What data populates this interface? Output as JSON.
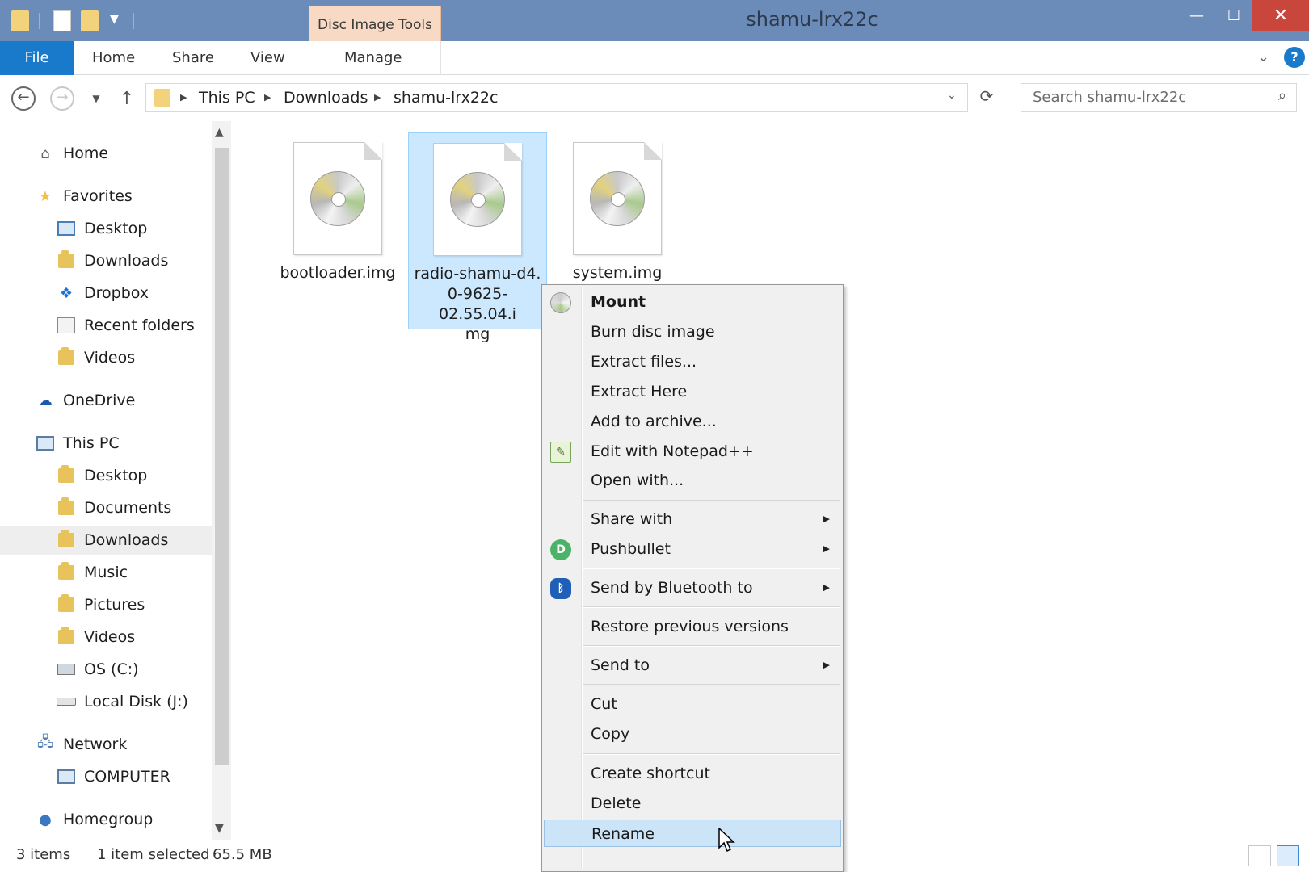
{
  "window": {
    "title": "shamu-lrx22c",
    "contextual_tab_group": "Disc Image Tools",
    "controls": {
      "minimize": "—",
      "maximize": "☐",
      "close": "✕"
    }
  },
  "ribbon": {
    "tabs": [
      "File",
      "Home",
      "Share",
      "View",
      "Manage"
    ],
    "help": "?"
  },
  "address": {
    "breadcrumbs": [
      "This PC",
      "Downloads",
      "shamu-lrx22c"
    ],
    "search_placeholder": "Search shamu-lrx22c"
  },
  "nav": {
    "items": [
      {
        "label": "Home",
        "icon": "home-icon"
      },
      {
        "label": "Favorites",
        "icon": "star-icon"
      },
      {
        "label": "Desktop",
        "icon": "desktop-icon"
      },
      {
        "label": "Downloads",
        "icon": "downloads-folder-icon"
      },
      {
        "label": "Dropbox",
        "icon": "dropbox-icon"
      },
      {
        "label": "Recent folders",
        "icon": "recent-folders-icon"
      },
      {
        "label": "Videos",
        "icon": "videos-folder-icon"
      },
      {
        "label": "OneDrive",
        "icon": "onedrive-icon"
      },
      {
        "label": "This PC",
        "icon": "computer-icon"
      },
      {
        "label": "Desktop",
        "icon": "folder-icon"
      },
      {
        "label": "Documents",
        "icon": "folder-icon"
      },
      {
        "label": "Downloads",
        "icon": "folder-icon"
      },
      {
        "label": "Music",
        "icon": "folder-icon"
      },
      {
        "label": "Pictures",
        "icon": "folder-icon"
      },
      {
        "label": "Videos",
        "icon": "folder-icon"
      },
      {
        "label": "OS (C:)",
        "icon": "drive-icon"
      },
      {
        "label": "Local Disk (J:)",
        "icon": "disk-icon"
      },
      {
        "label": "Network",
        "icon": "network-icon"
      },
      {
        "label": "COMPUTER",
        "icon": "computer-icon"
      },
      {
        "label": "Homegroup",
        "icon": "homegroup-icon"
      }
    ],
    "selected_index": 11
  },
  "files": [
    {
      "name": "bootloader.img",
      "selected": false
    },
    {
      "name_lines": [
        "radio-shamu-d4.",
        "0-9625-02.55.04.i",
        "mg"
      ],
      "selected": true
    },
    {
      "name": "system.img",
      "selected": false
    }
  ],
  "context_menu": {
    "items": [
      {
        "label": "Mount",
        "bold": true,
        "icon": "disc-icon"
      },
      {
        "label": "Burn disc image"
      },
      {
        "label": "Extract files..."
      },
      {
        "label": "Extract Here"
      },
      {
        "label": "Add to archive..."
      },
      {
        "label": "Edit with Notepad++",
        "icon": "notepad-icon"
      },
      {
        "label": "Open with..."
      },
      {
        "label": "Share with",
        "submenu": true
      },
      {
        "label": "Pushbullet",
        "submenu": true,
        "icon": "pushbullet-icon"
      },
      {
        "label": "Send by Bluetooth to",
        "submenu": true,
        "icon": "bluetooth-icon"
      },
      {
        "label": "Restore previous versions"
      },
      {
        "label": "Send to",
        "submenu": true
      },
      {
        "label": "Cut"
      },
      {
        "label": "Copy"
      },
      {
        "label": "Create shortcut"
      },
      {
        "label": "Delete"
      },
      {
        "label": "Rename",
        "highlighted": true
      }
    ],
    "submenu_arrow": "▶"
  },
  "status": {
    "item_count": "3 items",
    "selection": "1 item selected",
    "size": "65.5 MB"
  },
  "colors": {
    "titlebar": "#6b8cb8",
    "file_tab": "#1979ca",
    "close_button": "#c9463d",
    "selection": "#cce8ff",
    "menu_highlight": "#cce4f7"
  }
}
